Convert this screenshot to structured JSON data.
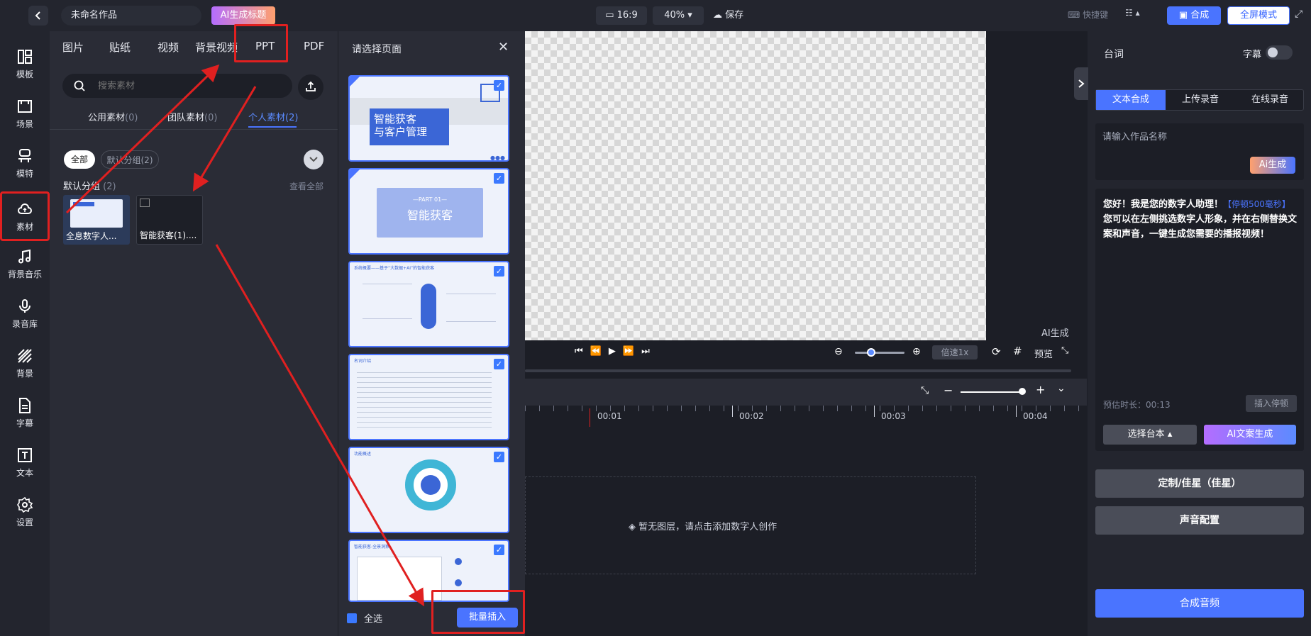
{
  "topbar": {
    "project_title": "未命名作品",
    "ai_title_label": "AI生成标题",
    "ratio_label": "16:9",
    "zoom_label": "40%",
    "save_label": "保存",
    "shortcut_label": "快捷键",
    "compose_label": "合成",
    "fullscreen_label": "全屏模式"
  },
  "rail": {
    "items": [
      {
        "label": "模板",
        "icon": "template-icon"
      },
      {
        "label": "场景",
        "icon": "scene-icon"
      },
      {
        "label": "模特",
        "icon": "model-icon"
      },
      {
        "label": "素材",
        "icon": "cloud-icon"
      },
      {
        "label": "背景音乐",
        "icon": "music-icon"
      },
      {
        "label": "录音库",
        "icon": "mic-icon"
      },
      {
        "label": "背景",
        "icon": "background-icon"
      },
      {
        "label": "字幕",
        "icon": "subtitle-icon"
      },
      {
        "label": "文本",
        "icon": "text-icon"
      },
      {
        "label": "设置",
        "icon": "settings-icon"
      }
    ],
    "active": "素材"
  },
  "materials": {
    "tabs": [
      "图片",
      "贴纸",
      "视频",
      "背景视频",
      "PPT",
      "PDF"
    ],
    "search_placeholder": "搜索素材",
    "subtabs": [
      {
        "label": "公用素材",
        "count": "(0)"
      },
      {
        "label": "团队素材",
        "count": "(0)"
      },
      {
        "label": "个人素材",
        "count": "(2)"
      }
    ],
    "chips": [
      "全部",
      "默认分组(2)"
    ],
    "group_label": "默认分组",
    "group_count": "(2)",
    "view_all": "查看全部",
    "items": [
      {
        "caption": "全息数字人..."
      },
      {
        "caption": "智能获客(1)...."
      }
    ]
  },
  "page_select": {
    "title": "请选择页面",
    "slides": [
      {
        "title_line1": "智能获客",
        "title_line2": "与客户管理"
      },
      {
        "part": "—PART 01—",
        "title": "智能获客"
      },
      {
        "header": "系统概要——基于“大数据+AI”的智能获客"
      },
      {
        "header": "名词介绍"
      },
      {
        "header": "功能概述"
      },
      {
        "header": "智能获客-全景洞察"
      }
    ],
    "select_all": "全选",
    "batch_insert": "批量插入"
  },
  "preview": {
    "ai_gen_label": "AI生成",
    "speed_label": "倍速1x",
    "preview_label": "预览"
  },
  "timeline": {
    "ticks": [
      "00:01",
      "00:02",
      "00:03",
      "00:04"
    ],
    "empty_text": "暂无图层，请点击添加数字人创作"
  },
  "right_panel": {
    "title": "台词",
    "subtitle_toggle": "字幕",
    "seg_tabs": [
      "文本合成",
      "上传录音",
      "在线录音"
    ],
    "name_placeholder": "请输入作品名称",
    "ai_gen": "Ai生成",
    "script_text_1": "您好！我是您的数字人助理！",
    "pause_tag": "【停顿500毫秒】",
    "script_text_2": "您可以在左侧挑选数字人形象，并在右侧替换文案和声音，一键生成您需要的播报视频！",
    "duration": "预估时长：00:13",
    "insert_pause": "插入停顿",
    "pick_script": "选择台本",
    "ai_copy": "AI文案生成",
    "custom_voice": "定制/佳星（佳星）",
    "voice_config": "声音配置",
    "compose_audio": "合成音频"
  },
  "colors": {
    "accent": "#4a74ff",
    "annotation_red": "#e02020"
  }
}
